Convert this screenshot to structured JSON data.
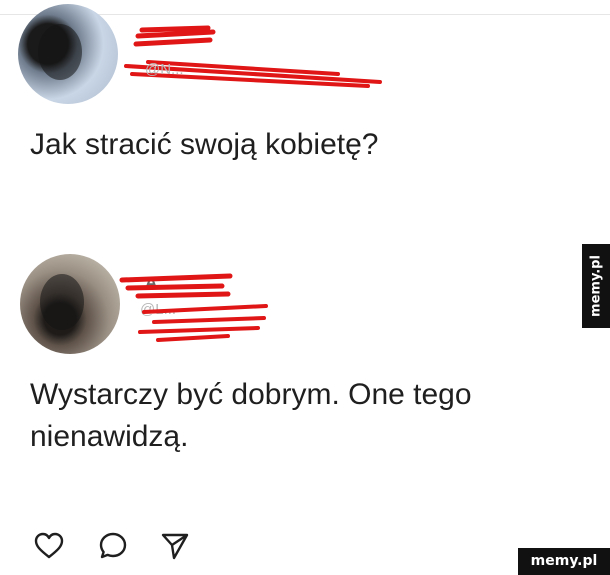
{
  "post_1": {
    "handle": "@N...",
    "text": "Jak stracić swoją kobietę?"
  },
  "post_2": {
    "name": "A...",
    "handle": "@L...",
    "text": "Wystarczy być dobrym. One tego nienawidzą."
  },
  "actions": {
    "like_icon": "heart-icon",
    "comment_icon": "comment-bubble-icon",
    "share_icon": "send-arrow-icon"
  },
  "watermark": {
    "side_text": "memy.pl",
    "corner_text": "memy.pl"
  },
  "colors": {
    "censor_red": "#e01515",
    "text": "#1f1f1f",
    "watermark_bg": "#111111"
  }
}
